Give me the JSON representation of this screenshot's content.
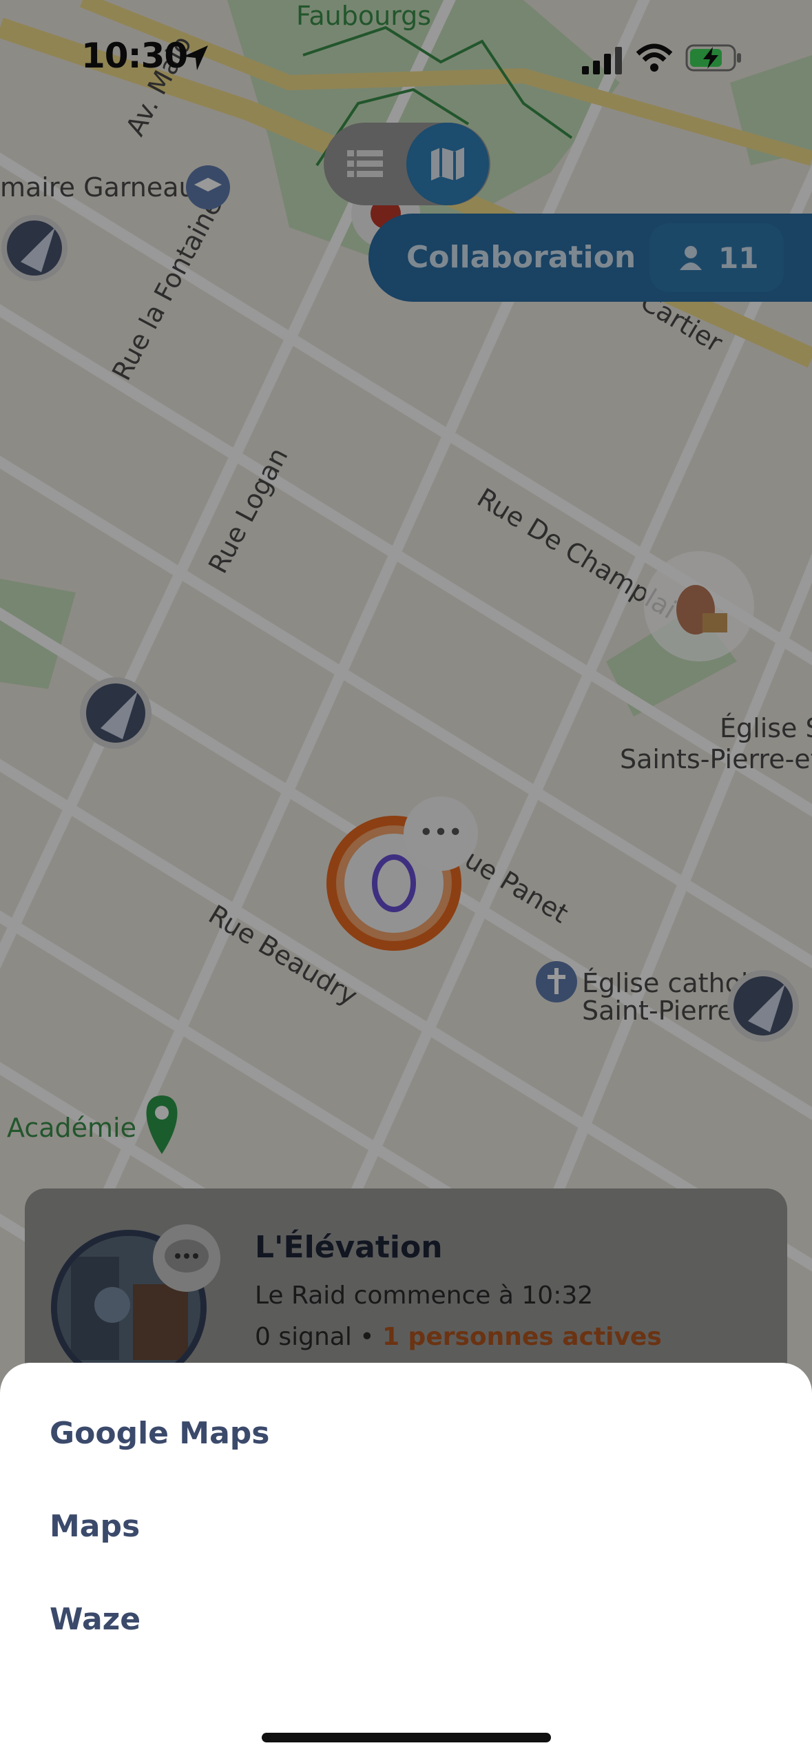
{
  "status_bar": {
    "time": "10:30"
  },
  "map": {
    "labels": {
      "faubourgs": "Faubourgs",
      "av_malo": "Av. Malo",
      "garneau": "maire Garneau",
      "rue_la_fontaine": "Rue la Fontaine",
      "r_cartier": "R. Cartier",
      "rue_logan": "Rue Logan",
      "rue_de_champlain": "Rue De Champlai",
      "eglise_s": "Église S",
      "saints_pierre": "Saints-Pierre-et",
      "rue_panet": "ue Panet",
      "rue_beaudry": "Rue Beaudry",
      "eglise_catholique": "Église catholi",
      "saint_pierre": "Saint-Pierre",
      "academie": "Académie"
    }
  },
  "view_toggle": {
    "list_icon": "list-icon",
    "map_icon": "map-icon"
  },
  "collaboration": {
    "label": "Collaboration",
    "count": "11",
    "icon": "person-icon"
  },
  "raid_card": {
    "title": "L'Élévation",
    "subtitle": "Le Raid commence à 10:32",
    "signal": "0 signal",
    "separator": " • ",
    "active": "1 personnes actives"
  },
  "sheet": {
    "options": [
      "Google Maps",
      "Maps",
      "Waze"
    ]
  },
  "colors": {
    "accent_blue": "#2f7fb7",
    "active_orange": "#d86a2c",
    "sheet_text": "#3b4a6b"
  }
}
